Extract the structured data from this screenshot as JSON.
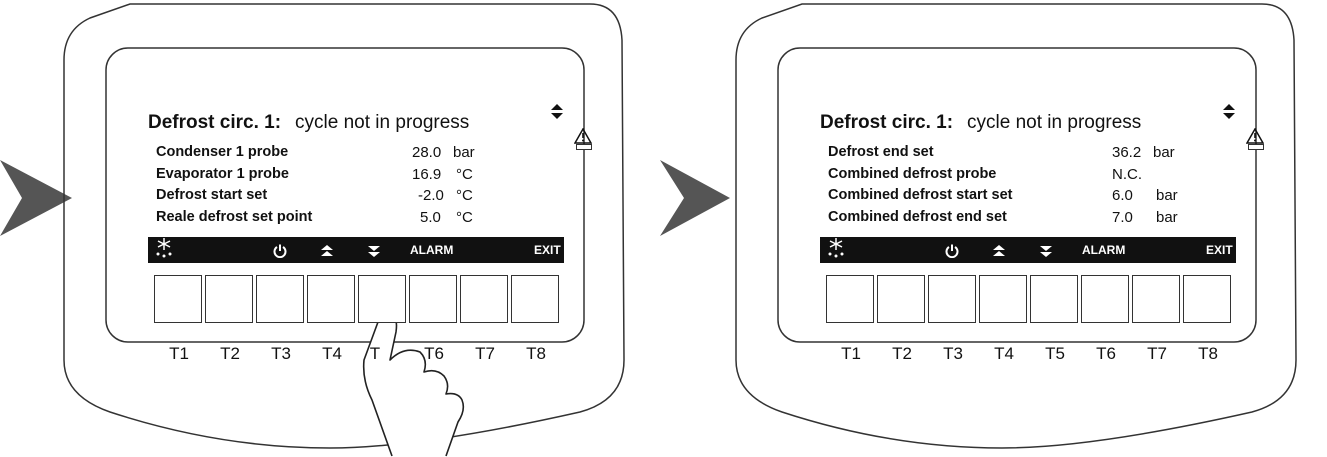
{
  "panels": [
    {
      "title_bold": "Defrost circ. 1:",
      "title_status": "cycle not in progress",
      "rows": [
        {
          "label": "Condenser 1 probe",
          "value": "28.0",
          "unit": "bar"
        },
        {
          "label": "Evaporator 1 probe",
          "value": "16.9",
          "unit": "°C"
        },
        {
          "label": "Defrost start set",
          "value": "-2.0",
          "unit": "°C"
        },
        {
          "label": "Reale defrost set point",
          "value": "5.0",
          "unit": "°C"
        }
      ]
    },
    {
      "title_bold": "Defrost circ. 1:",
      "title_status": "cycle not in progress",
      "rows": [
        {
          "label": "Defrost end set",
          "value": "36.2",
          "unit": "bar"
        },
        {
          "label": "Combined defrost probe",
          "value": "N.C.",
          "unit": ""
        },
        {
          "label": "Combined defrost start set",
          "value": "6.0",
          "unit": "bar"
        },
        {
          "label": "Combined defrost end set",
          "value": "7.0",
          "unit": "bar"
        }
      ]
    }
  ],
  "softkeys": {
    "defrost_icon": "defrost-icon",
    "power_icon": "power-icon",
    "up_icon": "page-up-icon",
    "down_icon": "page-down-icon",
    "alarm": "ALARM",
    "exit": "EXIT"
  },
  "key_labels": [
    "T1",
    "T2",
    "T3",
    "T4",
    "T5",
    "T6",
    "T7",
    "T8"
  ],
  "left_key_labels": [
    "T1",
    "T2",
    "T3",
    "T4",
    "T",
    "T6",
    "T7",
    "T8"
  ],
  "pressed_key": "T5",
  "colors": {
    "screen_bar": "#111111",
    "arrow": "#555555"
  }
}
